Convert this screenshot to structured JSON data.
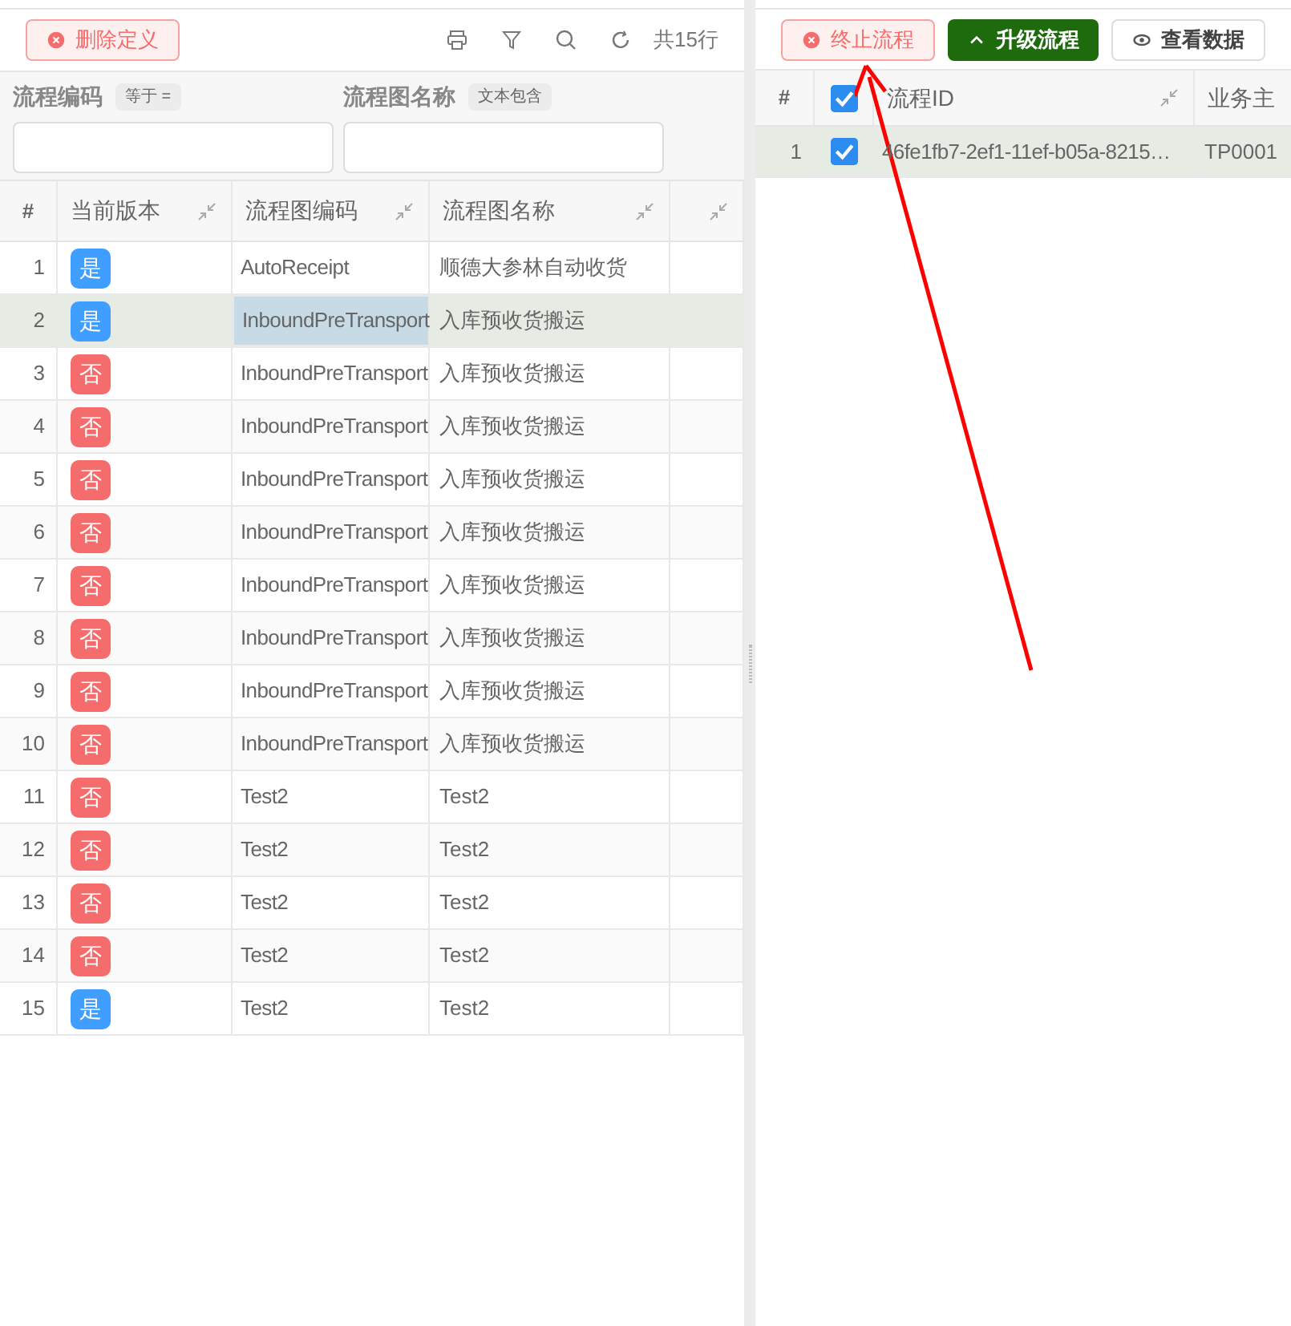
{
  "left": {
    "toolbar": {
      "delete_button": "删除定义",
      "row_count": "共15行"
    },
    "filters": [
      {
        "label": "流程编码",
        "operator": "等于 ="
      },
      {
        "label": "流程图名称",
        "operator": "文本包含"
      }
    ],
    "table": {
      "columns": [
        "#",
        "当前版本",
        "流程图编码",
        "流程图名称"
      ],
      "rows": [
        {
          "index": "1",
          "current": true,
          "badge": "是",
          "code": "AutoReceipt",
          "name": "顺德大参林自动收货",
          "selected": false,
          "code_focused": false
        },
        {
          "index": "2",
          "current": true,
          "badge": "是",
          "code": "InboundPreTransport",
          "name": "入库预收货搬运",
          "selected": true,
          "code_focused": true
        },
        {
          "index": "3",
          "current": false,
          "badge": "否",
          "code": "InboundPreTransport",
          "name": "入库预收货搬运",
          "selected": false,
          "code_focused": false
        },
        {
          "index": "4",
          "current": false,
          "badge": "否",
          "code": "InboundPreTransport",
          "name": "入库预收货搬运",
          "selected": false,
          "code_focused": false
        },
        {
          "index": "5",
          "current": false,
          "badge": "否",
          "code": "InboundPreTransport",
          "name": "入库预收货搬运",
          "selected": false,
          "code_focused": false
        },
        {
          "index": "6",
          "current": false,
          "badge": "否",
          "code": "InboundPreTransport",
          "name": "入库预收货搬运",
          "selected": false,
          "code_focused": false
        },
        {
          "index": "7",
          "current": false,
          "badge": "否",
          "code": "InboundPreTransport",
          "name": "入库预收货搬运",
          "selected": false,
          "code_focused": false
        },
        {
          "index": "8",
          "current": false,
          "badge": "否",
          "code": "InboundPreTransport",
          "name": "入库预收货搬运",
          "selected": false,
          "code_focused": false
        },
        {
          "index": "9",
          "current": false,
          "badge": "否",
          "code": "InboundPreTransport",
          "name": "入库预收货搬运",
          "selected": false,
          "code_focused": false
        },
        {
          "index": "10",
          "current": false,
          "badge": "否",
          "code": "InboundPreTransport",
          "name": "入库预收货搬运",
          "selected": false,
          "code_focused": false
        },
        {
          "index": "11",
          "current": false,
          "badge": "否",
          "code": "Test2",
          "name": "Test2",
          "selected": false,
          "code_focused": false
        },
        {
          "index": "12",
          "current": false,
          "badge": "否",
          "code": "Test2",
          "name": "Test2",
          "selected": false,
          "code_focused": false
        },
        {
          "index": "13",
          "current": false,
          "badge": "否",
          "code": "Test2",
          "name": "Test2",
          "selected": false,
          "code_focused": false
        },
        {
          "index": "14",
          "current": false,
          "badge": "否",
          "code": "Test2",
          "name": "Test2",
          "selected": false,
          "code_focused": false
        },
        {
          "index": "15",
          "current": true,
          "badge": "是",
          "code": "Test2",
          "name": "Test2",
          "selected": false,
          "code_focused": false
        }
      ]
    }
  },
  "right": {
    "buttons": [
      {
        "label": "终止流程",
        "kind": "danger"
      },
      {
        "label": "升级流程",
        "kind": "primary"
      },
      {
        "label": "查看数据",
        "kind": "default"
      }
    ],
    "table": {
      "columns": [
        "#",
        "流程ID",
        "业务主"
      ],
      "header_checked": true,
      "rows": [
        {
          "index": "1",
          "checked": true,
          "selected": true,
          "id": "46fe1fb7-2ef1-11ef-b05a-8215…",
          "key": "TP0001"
        }
      ]
    }
  }
}
